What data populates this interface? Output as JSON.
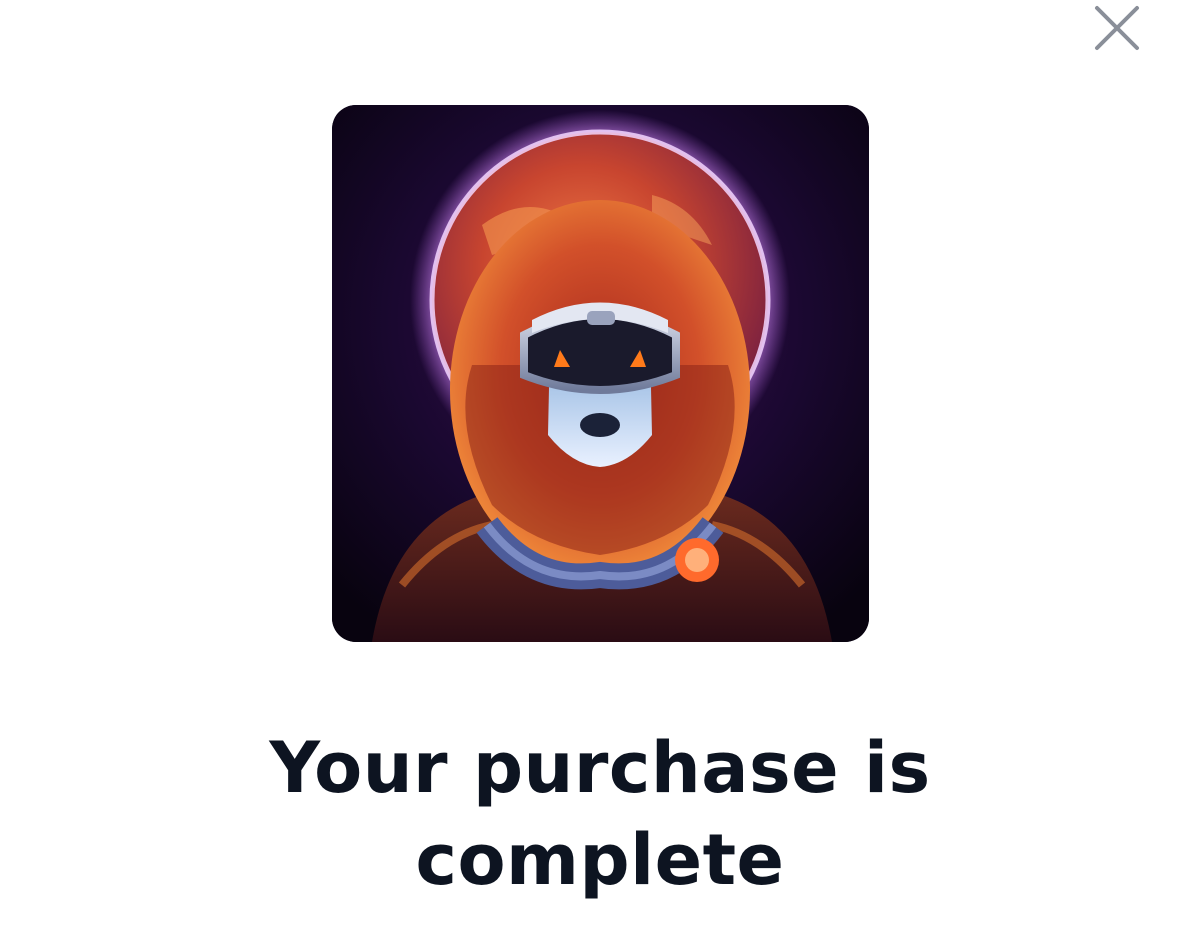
{
  "dialog": {
    "close_icon": "close-icon",
    "artwork_subject": "lion-astronaut-nft-artwork",
    "headline": "Your purchase is complete"
  },
  "colors": {
    "background": "#ffffff",
    "headline": "#0d1421",
    "close_icon": "#8a8f99",
    "artwork_background": "#10061f",
    "artwork_glow": "#c06cf0",
    "artwork_mane": "#e2562a"
  }
}
